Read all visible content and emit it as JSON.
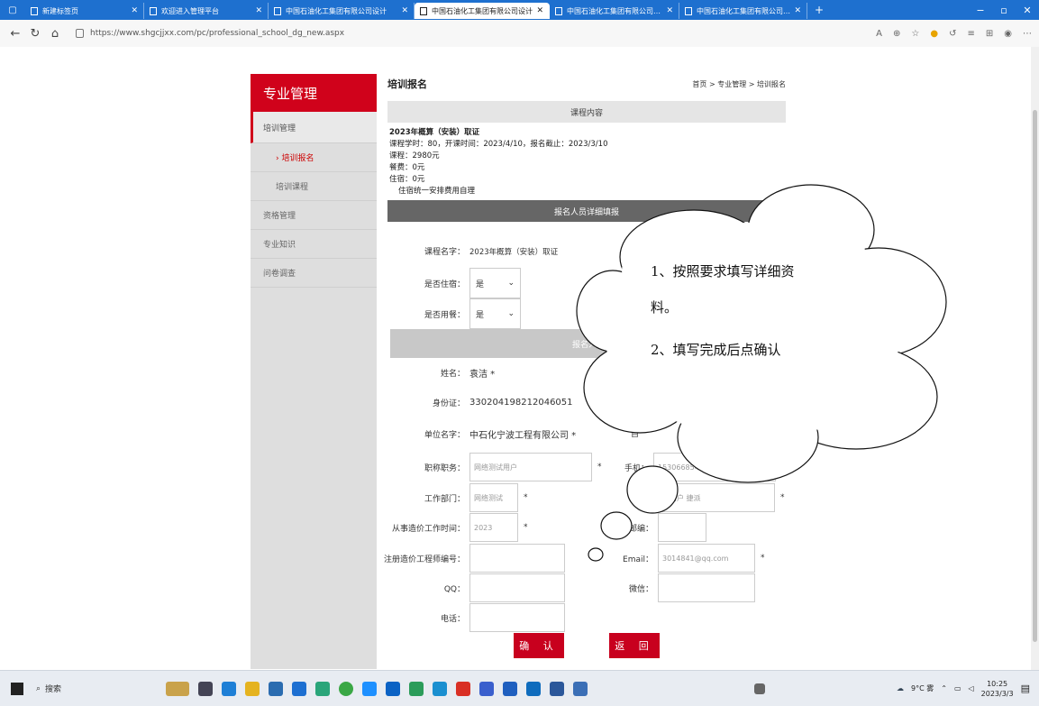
{
  "browser": {
    "tabs": [
      {
        "label": "新建标签页",
        "active": false
      },
      {
        "label": "欢迎进入管理平台",
        "active": false
      },
      {
        "label": "中国石油化工集团有限公司设计",
        "active": false
      },
      {
        "label": "中国石油化工集团有限公司设计",
        "active": true
      },
      {
        "label": "中国石油化工集团有限公司设计",
        "active": false
      },
      {
        "label": "中国石油化工集团有限公司设计",
        "active": false
      }
    ],
    "url": "https://www.shgcjjxx.com/pc/professional_school_dg_new.aspx",
    "new_tab": "+",
    "win_min": "−",
    "win_max": "▫",
    "win_close": "✕"
  },
  "sidebar": {
    "title": "专业管理",
    "items": [
      {
        "label": "培训管理"
      },
      {
        "label": "› 培训报名"
      },
      {
        "label": "培训课程"
      },
      {
        "label": "资格管理"
      },
      {
        "label": "专业知识"
      },
      {
        "label": "问卷调查"
      }
    ]
  },
  "main": {
    "title": "培训报名",
    "breadcrumb": "首页 > 专业管理 > 培训报名",
    "course_section": "课程内容",
    "course": {
      "name": "2023年概算（安装）取证",
      "schedule": "课程学时：80，开课时间：2023/4/10，报名截止：2023/3/10",
      "fee": "课程：2980元",
      "meal": "餐费：0元",
      "stay": "住宿：0元",
      "note": "住宿统一安排费用自理"
    },
    "detail_header": "报名人员详细填报",
    "info_header": "报名人员",
    "form": {
      "course_label": "课程名字：",
      "course_value": "2023年概算（安装）取证",
      "stay_label": "是否住宿：",
      "stay_value": "是",
      "meal_label": "是否用餐：",
      "meal_value": "是",
      "name_label": "姓名：",
      "name_value": "袁洁 *",
      "id_label": "身份证：",
      "id_value": "330204198212046051",
      "unit_label": "单位名字：",
      "unit_value": "中石化宁波工程有限公司 *",
      "title_label": "职称职务：",
      "title_value": "网络测试用户",
      "phone_label": "手机：",
      "phone_value": "15306685419",
      "dept_label": "工作部门：",
      "dept_value": "网络测试",
      "right_mid_value": "测试用户 捷派",
      "years_label": "从事造价工作时间：",
      "years_value": "2023",
      "zip_label": "邮编：",
      "zip_value": "",
      "reg_label": "注册造价工程师编号：",
      "reg_value": "",
      "email_label": "Email：",
      "email_value": "3014841@qq.com",
      "qq_label": "QQ：",
      "qq_value": "",
      "wechat_label": "微信：",
      "wechat_value": "",
      "tel_label": "电话：",
      "tel_value": "",
      "required": "*",
      "right_mark": "自"
    },
    "confirm_button": "确 认",
    "back_button": "返 回"
  },
  "callout": {
    "line1": "1、按照要求填写详细资",
    "line2": "料。",
    "line3": "2、填写完成后点确认"
  },
  "taskbar": {
    "search": "搜索",
    "weather": "9°C 雾",
    "time": "10:25",
    "date": "2023/3/3"
  }
}
